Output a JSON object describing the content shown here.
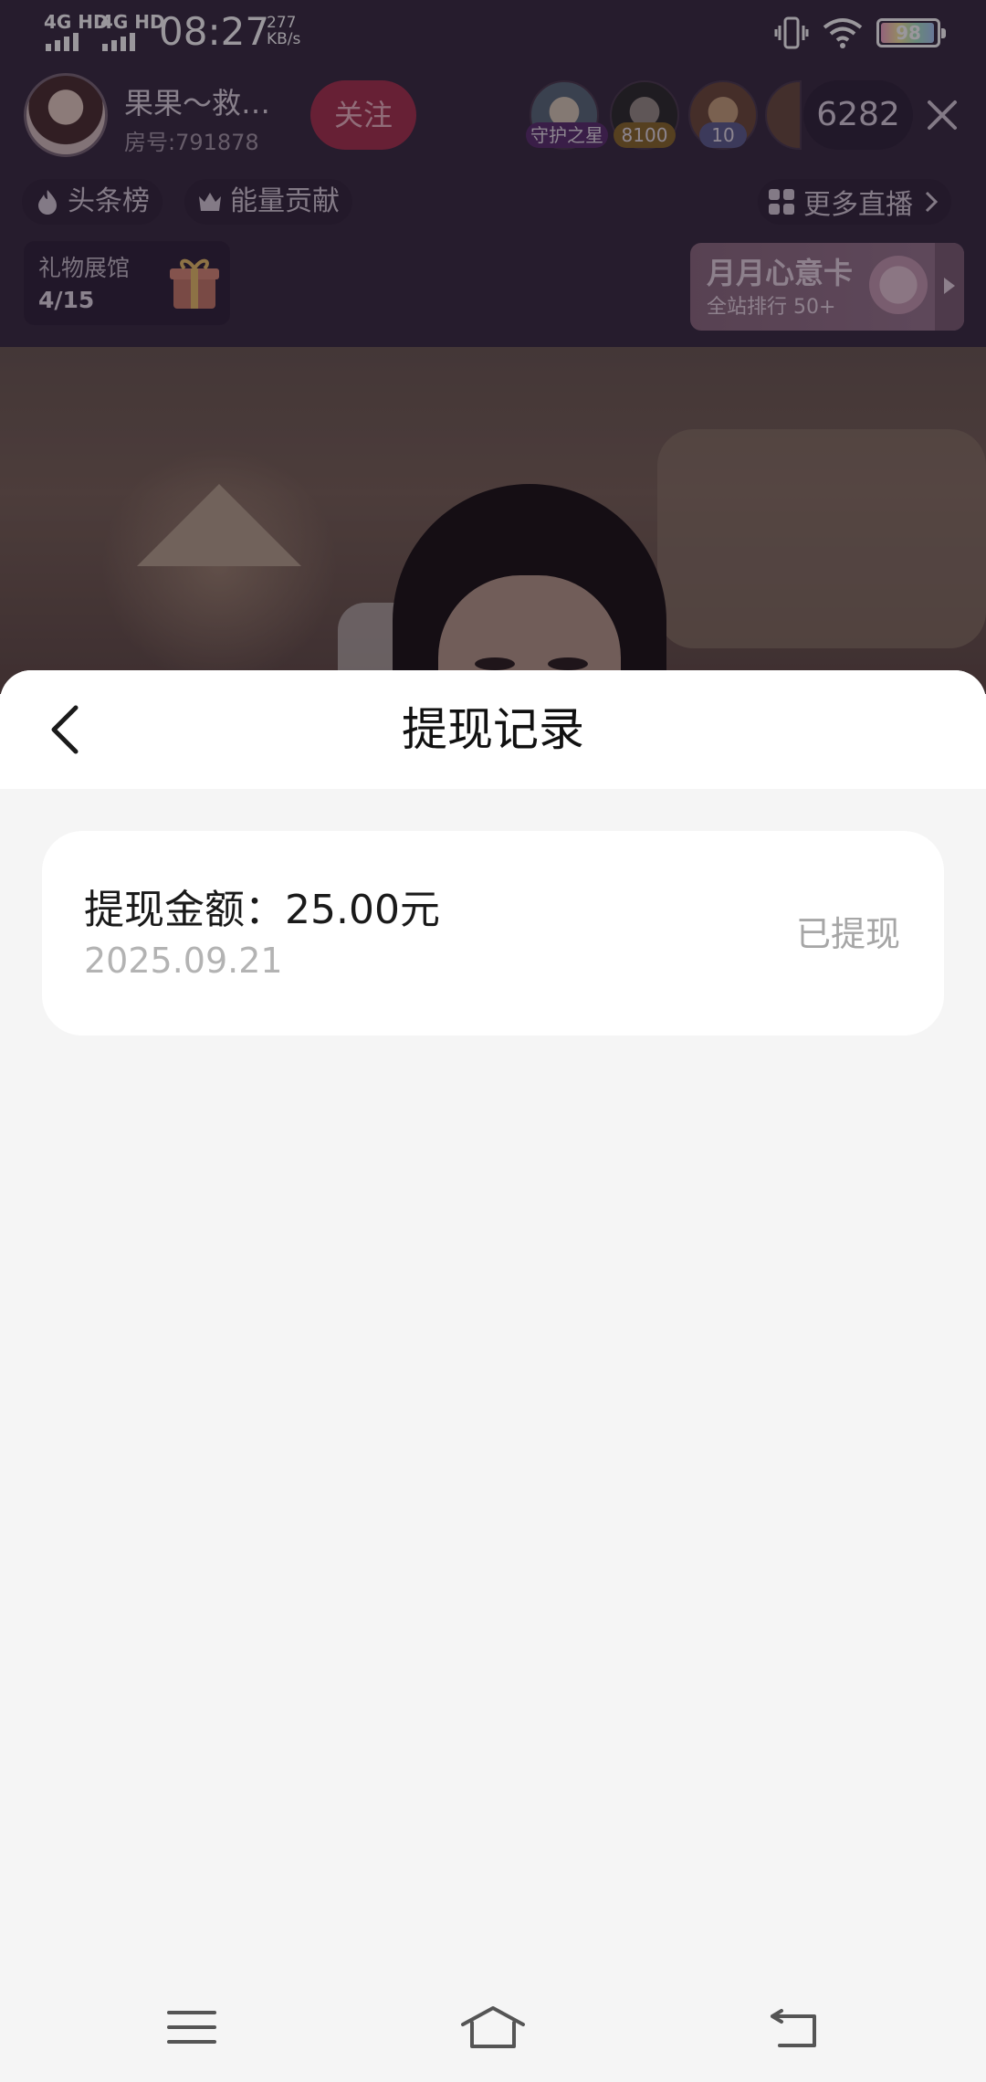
{
  "status_bar": {
    "signal_1": "4G HD",
    "signal_2": "4G HD",
    "time": "08:27",
    "net_speed_value": "277",
    "net_speed_unit": "KB/s",
    "battery": "98"
  },
  "live_room": {
    "streamer_name": "果果～救…",
    "room_id": "房号:791878",
    "follow_label": "关注",
    "viewers": [
      {
        "badge": "守护之星",
        "badge_color": "#5a2f6e"
      },
      {
        "badge": "8100",
        "badge_color": "#8a6a2a"
      },
      {
        "badge": "10",
        "badge_color": "#5d5f8f"
      },
      {
        "badge": "",
        "badge_color": ""
      }
    ],
    "viewer_count": "6282",
    "chips": {
      "headline_rank": "头条榜",
      "energy_contribution": "能量贡献",
      "more_live": "更多直播"
    },
    "gift_hall": {
      "title": "礼物展馆",
      "count": "4/15"
    },
    "month_card": {
      "title": "月月心意卡",
      "subtitle": "全站排行 50+"
    }
  },
  "sheet": {
    "title": "提现记录",
    "records": [
      {
        "amount_label": "提现金额：25.00元",
        "date": "2025.09.21",
        "status": "已提现"
      }
    ]
  },
  "colors": {
    "follow_button": "#a8324f",
    "sheet_background": "#f5f5f5",
    "card_background": "#ffffff",
    "muted_text": "#a6a6a6"
  }
}
